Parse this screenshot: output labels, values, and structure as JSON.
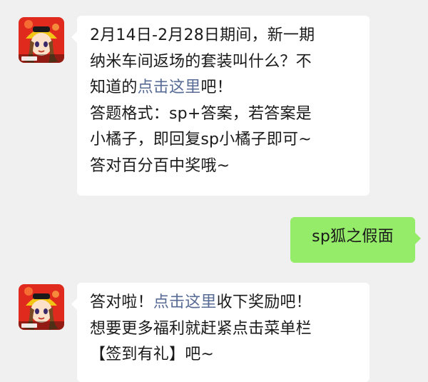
{
  "messages": [
    {
      "sender": "bot",
      "lines": [
        {
          "a": "2月14日-2月28日期间，新一期"
        },
        {
          "a": "纳米车间返场的套装叫什么？不"
        },
        {
          "a": "知道的",
          "link": "点击这里",
          "b": "吧！"
        },
        {
          "a": "答题格式：sp+答案，若答案是"
        },
        {
          "a": "小橘子，即回复sp小橘子即可~"
        },
        {
          "a": "答对百分百中奖哦~"
        }
      ]
    },
    {
      "sender": "user",
      "text": "sp狐之假面"
    },
    {
      "sender": "bot",
      "lines": [
        {
          "a": "答对啦！",
          "link": "点击这里",
          "b": "收下奖励吧！"
        },
        {
          "a": "想要更多福利就赶紧点击菜单栏"
        },
        {
          "a": "【签到有礼】吧~"
        }
      ]
    }
  ],
  "colors": {
    "background": "#f0f0f0",
    "bot_bubble": "#ffffff",
    "user_bubble": "#95ec69",
    "link": "#576b95"
  },
  "avatar_icon": "qq-speed-character-avatar"
}
